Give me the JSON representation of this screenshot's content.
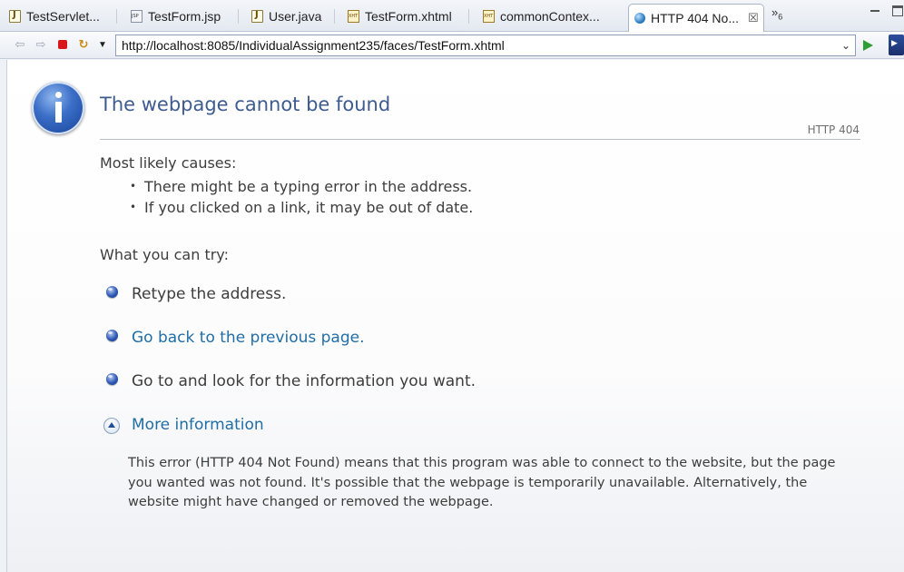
{
  "tabs": [
    {
      "label": "TestServlet...",
      "icon": "java-file-icon"
    },
    {
      "label": "TestForm.jsp",
      "icon": "jsp-file-icon"
    },
    {
      "label": "User.java",
      "icon": "java-file-icon"
    },
    {
      "label": "TestForm.xhtml",
      "icon": "xhtml-file-icon"
    },
    {
      "label": "commonContex...",
      "icon": "xhtml-file-icon"
    },
    {
      "label": "HTTP 404 No...",
      "icon": "globe-icon",
      "active": true
    }
  ],
  "tab_overflow": {
    "glyph": "»",
    "count": "6"
  },
  "toolbar": {
    "url": "http://localhost:8085/IndividualAssignment235/faces/TestForm.xhtml"
  },
  "page": {
    "title": "The webpage cannot be found",
    "status_code": "HTTP 404",
    "causes_heading": "Most likely causes:",
    "causes": [
      "There might be a typing error in the address.",
      "If you clicked on a link, it may be out of date."
    ],
    "try_heading": "What you can try:",
    "try_items": [
      {
        "text": "Retype the address.",
        "link": false
      },
      {
        "text": "Go back to the previous page.",
        "link": true
      },
      {
        "text": "Go to  and look for the information you want.",
        "link": false
      }
    ],
    "more_info_label": "More information",
    "detail": "This error (HTTP 404 Not Found) means that this program was able to connect to the website, but the page you wanted was not found. It's possible that the webpage is temporarily unavailable. Alternatively, the website might have changed or removed the webpage."
  },
  "colors": {
    "title": "#3f5c8e",
    "link": "#216ea5",
    "body_text": "#3d3d3d",
    "stop": "#d9161b",
    "go": "#2e9e34"
  }
}
